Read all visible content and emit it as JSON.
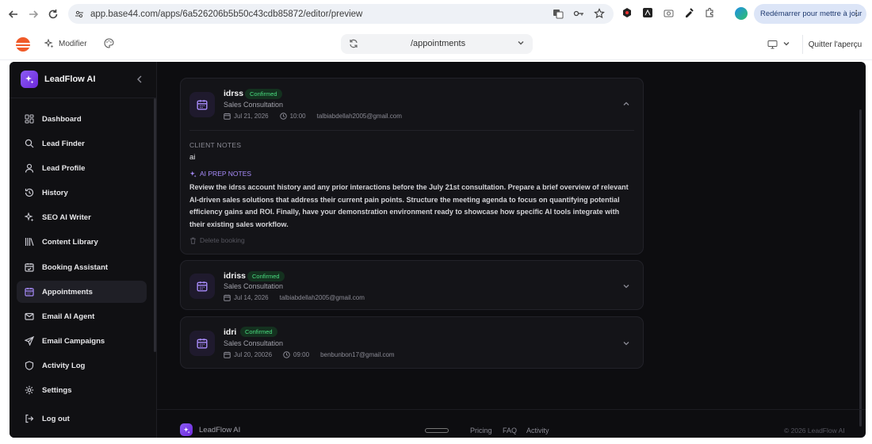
{
  "browser": {
    "url": "app.base44.com/apps/6a526206b5b50c43cdb85872/editor/preview",
    "restart_label": "Redémarrer pour mettre à jour"
  },
  "topbar": {
    "modify_label": "Modifier",
    "route": "/appointments",
    "quit_label": "Quitter l'aperçu"
  },
  "sidebar": {
    "brand": "LeadFlow AI",
    "items": [
      {
        "label": "Dashboard",
        "icon": "grid-icon"
      },
      {
        "label": "Lead Finder",
        "icon": "search-icon"
      },
      {
        "label": "Lead Profile",
        "icon": "user-icon"
      },
      {
        "label": "History",
        "icon": "history-icon"
      },
      {
        "label": "SEO AI Writer",
        "icon": "sparkle-icon"
      },
      {
        "label": "Content Library",
        "icon": "library-icon"
      },
      {
        "label": "Booking Assistant",
        "icon": "calendar-check-icon"
      },
      {
        "label": "Appointments",
        "icon": "calendar-icon",
        "active": true
      },
      {
        "label": "Email AI Agent",
        "icon": "mail-icon"
      },
      {
        "label": "Email Campaigns",
        "icon": "send-icon"
      },
      {
        "label": "Activity Log",
        "icon": "shield-icon"
      },
      {
        "label": "Settings",
        "icon": "gear-icon"
      }
    ],
    "logout_label": "Log out"
  },
  "appointments": [
    {
      "name": "idrss",
      "status": "Confirmed",
      "type": "Sales Consultation",
      "date": "Jul 21, 2026",
      "time": "10:00",
      "email": "talbiabdellah2005@gmail.com",
      "expanded": true,
      "client_notes_label": "CLIENT NOTES",
      "client_notes": "ai",
      "ai_notes_label": "AI PREP NOTES",
      "ai_notes": "Review the idrss account history and any prior interactions before the July 21st consultation. Prepare a brief overview of relevant AI-driven sales solutions that address their current pain points. Structure the meeting agenda to focus on quantifying potential efficiency gains and ROI. Finally, have your demonstration environment ready to showcase how specific AI tools integrate with their existing sales workflow.",
      "delete_label": "Delete booking"
    },
    {
      "name": "idriss",
      "status": "Confirmed",
      "type": "Sales Consultation",
      "date": "Jul 14, 2026",
      "email": "talbiabdellah2005@gmail.com"
    },
    {
      "name": "idri",
      "status": "Confirmed",
      "type": "Sales Consultation",
      "date": "Jul 20, 20026",
      "time": "09:00",
      "email": "benbunbon17@gmail.com"
    }
  ],
  "footer": {
    "brand": "LeadFlow AI",
    "links": [
      "Pricing",
      "FAQ",
      "Activity"
    ],
    "copyright": "© 2026 LeadFlow AI"
  },
  "colors": {
    "accent": "#8b5cf6",
    "confirmed": "#4ade80",
    "background": "#0d0d10"
  }
}
